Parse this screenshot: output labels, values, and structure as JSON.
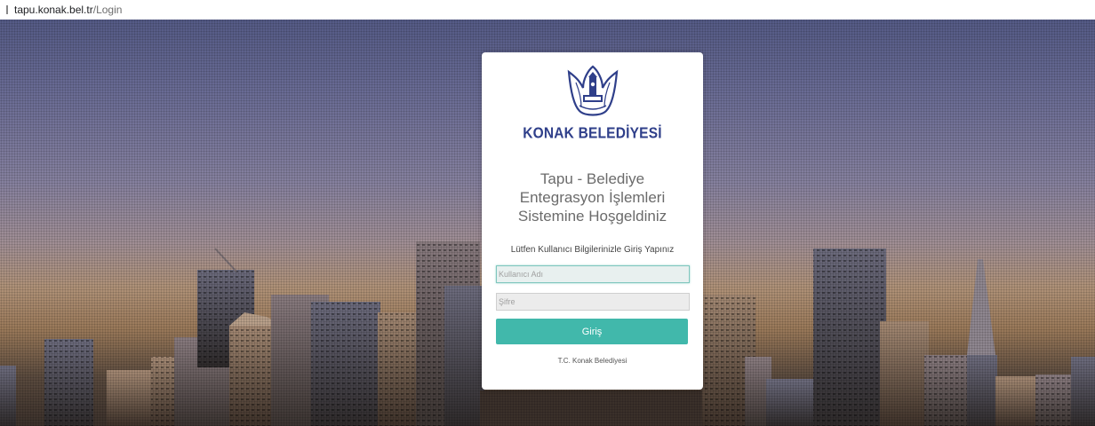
{
  "browser": {
    "url_host": "tapu.konak.bel.tr",
    "url_path": "/Login"
  },
  "login": {
    "brand_name": "KONAK BELEDİYESİ",
    "welcome_title": "Tapu - Belediye\nEntegrasyon İşlemleri\nSistemine Hoşgeldiniz",
    "instruction": "Lütfen Kullanıcı Bilgilerinizle Giriş Yapınız",
    "username_placeholder": "Kullanıcı Adı",
    "username_value": "",
    "password_placeholder": "Şifre",
    "password_value": "",
    "submit_label": "Giriş",
    "footer": "T.C. Konak Belediyesi"
  },
  "colors": {
    "brand_blue": "#2f3f8a",
    "accent_teal": "#41b8ab",
    "sky_top": "#555b86"
  },
  "icons": {
    "logo": "konak-tulip-logo-icon"
  }
}
